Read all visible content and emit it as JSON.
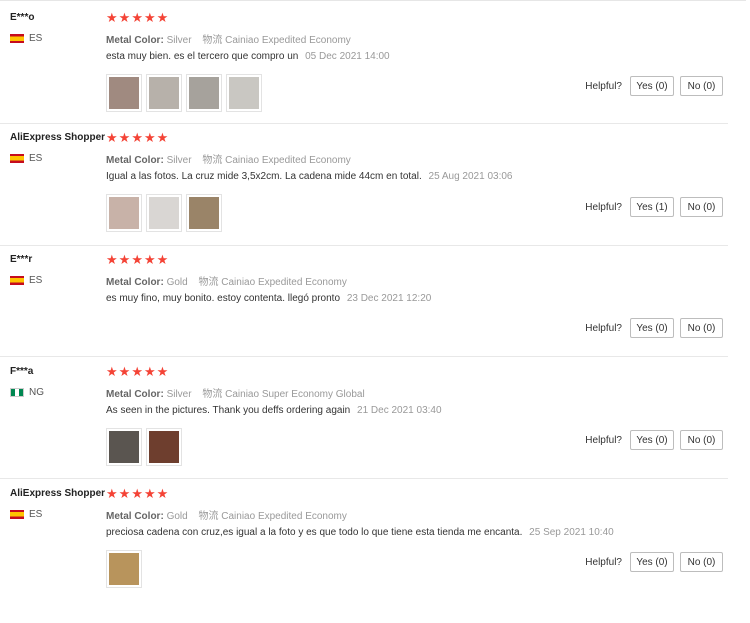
{
  "reviews": [
    {
      "user": "E***o",
      "country": "ES",
      "flag": "es",
      "stars": 5,
      "attr_label": "Metal Color:",
      "attr_value": "Silver",
      "shipping_label": "物流",
      "shipping_value": "Cainiao Expedited Economy",
      "content": "esta muy bien. es el tercero que compro un",
      "date": "05 Dec 2021 14:00",
      "photo_colors": [
        "#a08a80",
        "#b7b1aa",
        "#a6a29c",
        "#c9c7c2"
      ],
      "helpful_label": "Helpful?",
      "yes": "Yes (0)",
      "no": "No (0)"
    },
    {
      "user": "AliExpress Shopper",
      "country": "ES",
      "flag": "es",
      "stars": 5,
      "attr_label": "Metal Color:",
      "attr_value": "Silver",
      "shipping_label": "物流",
      "shipping_value": "Cainiao Expedited Economy",
      "content": "Igual a las fotos. La cruz mide 3,5x2cm. La cadena mide 44cm en total.",
      "date": "25 Aug 2021 03:06",
      "photo_colors": [
        "#c8b2a8",
        "#d9d6d3",
        "#9a8468"
      ],
      "helpful_label": "Helpful?",
      "yes": "Yes (1)",
      "no": "No (0)"
    },
    {
      "user": "E***r",
      "country": "ES",
      "flag": "es",
      "stars": 5,
      "attr_label": "Metal Color:",
      "attr_value": "Gold",
      "shipping_label": "物流",
      "shipping_value": "Cainiao Expedited Economy",
      "content": "es muy fino, muy bonito. estoy contenta. llegó pronto",
      "date": "23 Dec 2021 12:20",
      "photo_colors": [],
      "helpful_label": "Helpful?",
      "yes": "Yes (0)",
      "no": "No (0)"
    },
    {
      "user": "F***a",
      "country": "NG",
      "flag": "ng",
      "stars": 5,
      "attr_label": "Metal Color:",
      "attr_value": "Silver",
      "shipping_label": "物流",
      "shipping_value": "Cainiao Super Economy Global",
      "content": "As seen in the pictures. Thank you deffs ordering again",
      "date": "21 Dec 2021 03:40",
      "photo_colors": [
        "#5a5550",
        "#6e3e2e"
      ],
      "helpful_label": "Helpful?",
      "yes": "Yes (0)",
      "no": "No (0)"
    },
    {
      "user": "AliExpress Shopper",
      "country": "ES",
      "flag": "es",
      "stars": 5,
      "attr_label": "Metal Color:",
      "attr_value": "Gold",
      "shipping_label": "物流",
      "shipping_value": "Cainiao Expedited Economy",
      "content": "preciosa cadena con cruz,es igual a la foto y es que todo lo que tiene esta tienda me encanta.",
      "date": "25 Sep 2021 10:40",
      "photo_colors": [
        "#b8945c"
      ],
      "helpful_label": "Helpful?",
      "yes": "Yes (0)",
      "no": "No (0)"
    }
  ]
}
